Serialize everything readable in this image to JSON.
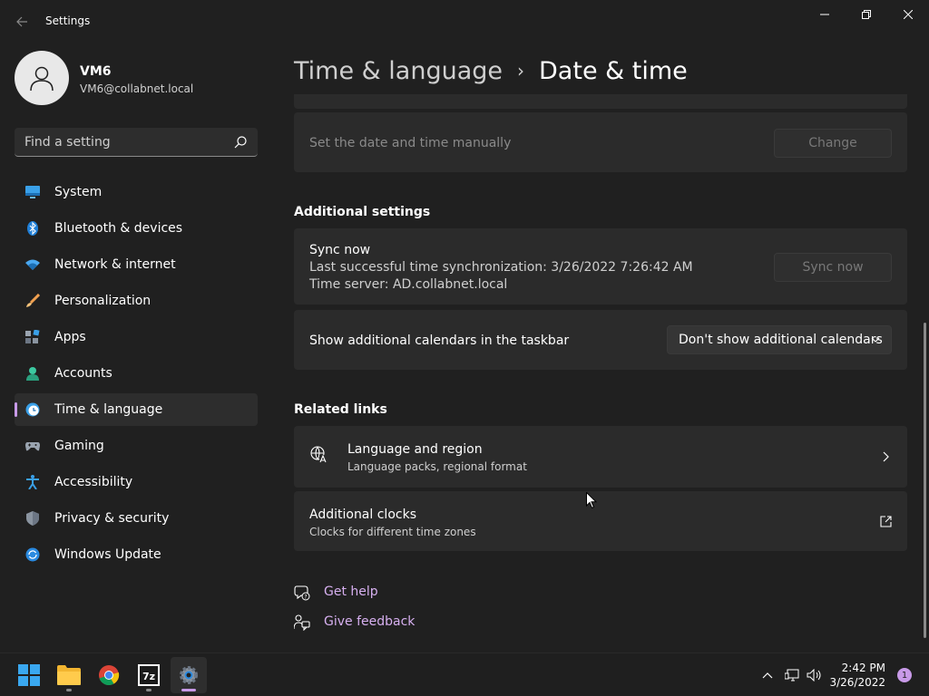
{
  "window": {
    "title": "Settings"
  },
  "profile": {
    "name": "VM6",
    "email": "VM6@collabnet.local"
  },
  "search": {
    "placeholder": "Find a setting"
  },
  "sidebar": {
    "items": [
      {
        "label": "System",
        "icon": "monitor-icon",
        "active": false
      },
      {
        "label": "Bluetooth & devices",
        "icon": "bluetooth-icon",
        "active": false
      },
      {
        "label": "Network & internet",
        "icon": "wifi-icon",
        "active": false
      },
      {
        "label": "Personalization",
        "icon": "brush-icon",
        "active": false
      },
      {
        "label": "Apps",
        "icon": "apps-icon",
        "active": false
      },
      {
        "label": "Accounts",
        "icon": "person-icon",
        "active": false
      },
      {
        "label": "Time & language",
        "icon": "clock-globe-icon",
        "active": true
      },
      {
        "label": "Gaming",
        "icon": "gamepad-icon",
        "active": false
      },
      {
        "label": "Accessibility",
        "icon": "accessibility-icon",
        "active": false
      },
      {
        "label": "Privacy & security",
        "icon": "shield-icon",
        "active": false
      },
      {
        "label": "Windows Update",
        "icon": "update-icon",
        "active": false
      }
    ]
  },
  "breadcrumb": {
    "parent": "Time & language",
    "separator": "›",
    "current": "Date & time"
  },
  "main": {
    "manual_time": {
      "label": "Set the date and time manually",
      "button": "Change"
    },
    "additional_settings": {
      "heading": "Additional settings",
      "sync": {
        "title": "Sync now",
        "last_sync": "Last successful time synchronization: 3/26/2022 7:26:42 AM",
        "time_server": "Time server: AD.collabnet.local",
        "button": "Sync now"
      },
      "calendars": {
        "label": "Show additional calendars in the taskbar",
        "selected": "Don't show additional calendars"
      }
    },
    "related_links": {
      "heading": "Related links",
      "language_region": {
        "title": "Language and region",
        "subtitle": "Language packs, regional format"
      },
      "additional_clocks": {
        "title": "Additional clocks",
        "subtitle": "Clocks for different time zones"
      }
    },
    "help": {
      "get_help": "Get help",
      "give_feedback": "Give feedback"
    }
  },
  "taskbar": {
    "apps": [
      "start",
      "file-explorer",
      "chrome",
      "7-zip",
      "settings"
    ],
    "time": "2:42 PM",
    "date": "3/26/2022",
    "notification_count": "1"
  },
  "colors": {
    "accent": "#c89ae8",
    "link": "#d7b0f0",
    "background": "#202020",
    "card": "#2b2b2b"
  }
}
